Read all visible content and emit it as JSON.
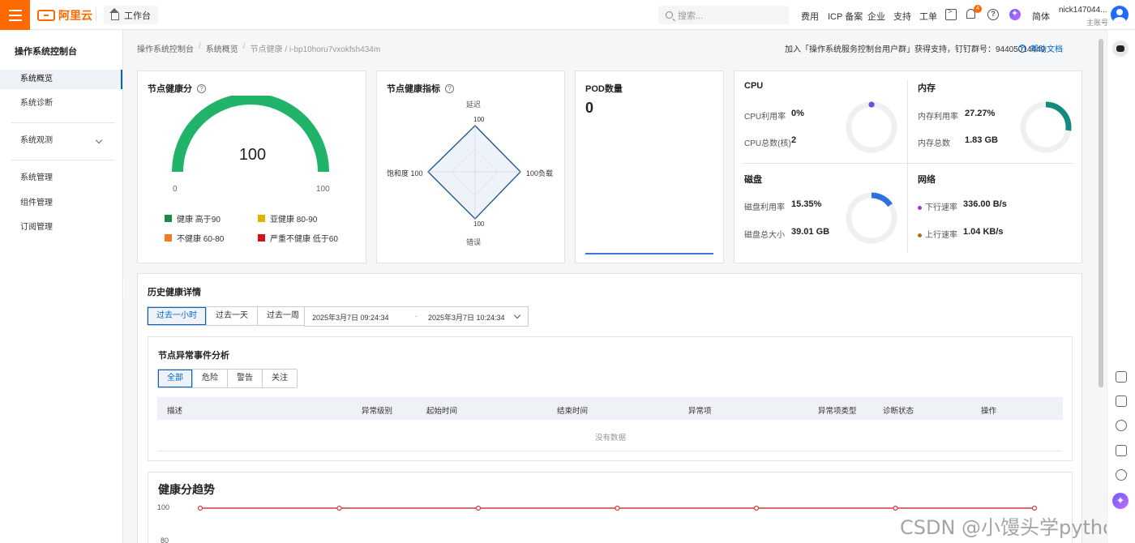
{
  "topbar": {
    "brand": "阿里云",
    "workbench": "工作台",
    "search_placeholder": "搜索...",
    "links": [
      "费用",
      "ICP 备案",
      "企业",
      "支持",
      "工单"
    ],
    "notification_count": "4",
    "language": "简体",
    "user_name": "nick147044...",
    "user_role": "主账号",
    "accent_color": "#ff6a00"
  },
  "sidebar": {
    "title": "操作系统控制台",
    "items": [
      "系统概览",
      "系统诊断",
      "系统观测",
      "系统管理",
      "组件管理",
      "订阅管理"
    ],
    "active": "系统概览"
  },
  "breadcrumb": [
    "操作系统控制台",
    "系统概览",
    "节点健康 / i-bp10horu7vxokfsh434m"
  ],
  "header_right": {
    "join_text": "加入「操作系统服务控制台用户群」获得支持，钉钉群号：94405014449",
    "help_doc": "帮助文档"
  },
  "health_score": {
    "title": "节点健康分",
    "value": "100",
    "min": "0",
    "max": "100",
    "color": "#22b36b",
    "legend": [
      {
        "label": "健康 高于90",
        "color": "#1b8a4c"
      },
      {
        "label": "亚健康 80-90",
        "color": "#e3b300"
      },
      {
        "label": "不健康 60-80",
        "color": "#f07c22"
      },
      {
        "label": "严重不健康 低于60",
        "color": "#d0141d"
      }
    ]
  },
  "health_indicator": {
    "title": "节点健康指标",
    "axes": [
      "延迟",
      "负载",
      "错误",
      "饱和度"
    ],
    "values": [
      "100",
      "100",
      "100",
      "100"
    ]
  },
  "pod": {
    "title": "POD数量",
    "value": "0"
  },
  "resources": {
    "cpu": {
      "title": "CPU",
      "usage_label": "CPU利用率",
      "usage_value": "0%",
      "usage": 0,
      "total_label": "CPU总数(核)",
      "total_value": "2",
      "ring_color": "#6a4fe0"
    },
    "memory": {
      "title": "内存",
      "usage_label": "内存利用率",
      "usage_value": "27.27%",
      "usage": 0.2727,
      "total_label": "内存总数",
      "total_value": "1.83 GB",
      "ring_color": "#118a80"
    },
    "disk": {
      "title": "磁盘",
      "usage_label": "磁盘利用率",
      "usage_value": "15.35%",
      "usage": 0.1535,
      "total_label": "磁盘总大小",
      "total_value": "39.01 GB",
      "ring_color": "#2f6fde"
    },
    "network": {
      "title": "网络",
      "down_label": "下行速率",
      "down_value": "336.00 B/s",
      "up_label": "上行速率",
      "up_value": "1.04 KB/s",
      "down_color": "#a03ac9",
      "up_color": "#b07010"
    }
  },
  "history": {
    "title": "历史健康详情",
    "ranges": [
      "过去一小时",
      "过去一天",
      "过去一周"
    ],
    "active_range": "过去一小时",
    "start": "2025年3月7日 09:24:34",
    "end": "2025年3月7日 10:24:34",
    "range_sep": "-"
  },
  "events": {
    "title": "节点异常事件分析",
    "filters": [
      "全部",
      "危险",
      "警告",
      "关注"
    ],
    "active_filter": "全部",
    "columns": [
      "描述",
      "异常级别",
      "起始时间",
      "结束时间",
      "异常项",
      "异常项类型",
      "诊断状态",
      "操作"
    ],
    "empty_text": "没有数据"
  },
  "trend": {
    "title": "健康分趋势",
    "y_ticks": [
      "100",
      "80"
    ],
    "line_color": "#d23b3b"
  },
  "chart_data": {
    "type": "line",
    "title": "健康分趋势",
    "y_ticks": [
      100,
      80
    ],
    "series": [
      {
        "values": [
          100,
          100,
          100,
          100,
          100,
          100,
          100
        ]
      }
    ]
  },
  "watermark": "CSDN @小馒头学python"
}
